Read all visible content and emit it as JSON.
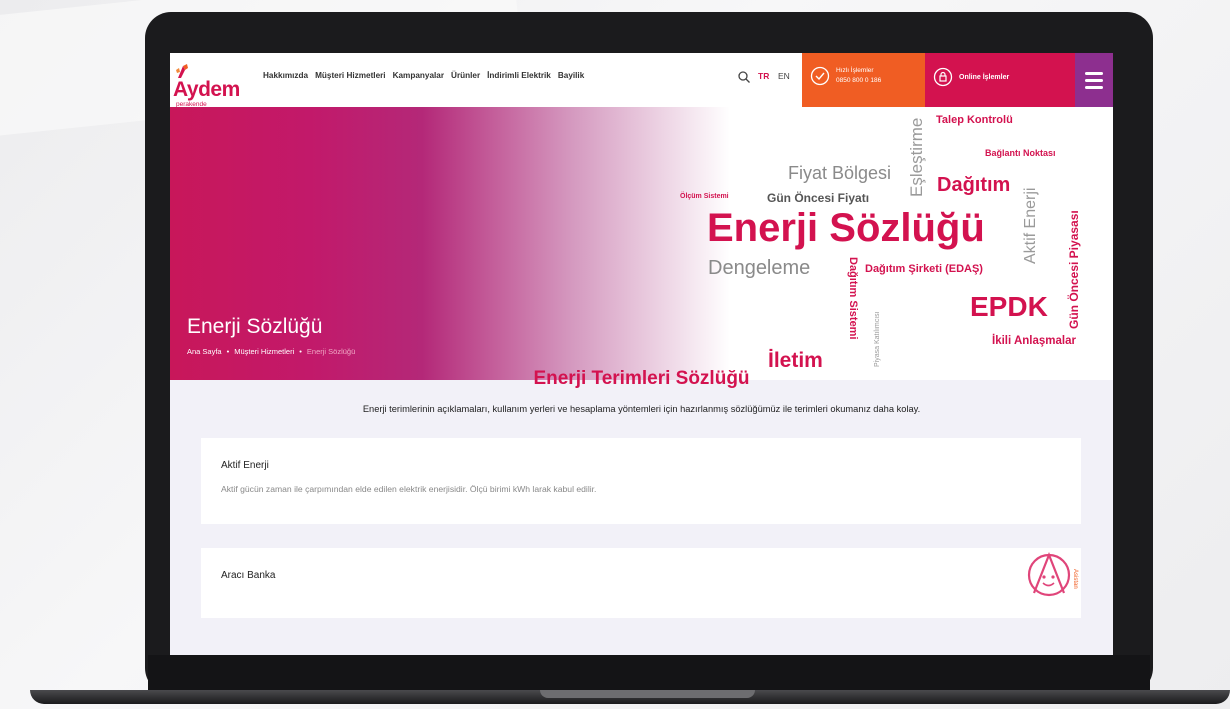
{
  "header": {
    "logo_text": "Aydem",
    "logo_subtext": "perakende",
    "nav": [
      "Hakkımızda",
      "Müşteri Hizmetleri",
      "Kampanyalar",
      "Ürünler",
      "İndirimli Elektrik",
      "Bayilik"
    ],
    "lang_tr": "TR",
    "lang_en": "EN",
    "quick_label": "Hızlı İşlemler",
    "quick_phone": "0850 800 0 186",
    "online_label": "Online İşlemler",
    "colors": {
      "brand": "#d3124f",
      "quick": "#f05d23",
      "menu": "#8d2f8f"
    }
  },
  "hero": {
    "title": "Enerji Sözlüğü",
    "breadcrumb": [
      "Ana Sayfa",
      "Müşteri Hizmetleri",
      "Enerji Sözlüğü"
    ],
    "cloud": {
      "talep": "Talep Kontrolü",
      "baglanti": "Bağlantı Noktası",
      "fiyat_bolgesi": "Fiyat Bölgesi",
      "eslestirme": "Eşleştirme",
      "dagitim": "Dağıtım",
      "olcum": "Ölçüm Sistemi",
      "gun_oncesi_fiyati": "Gün Öncesi Fiyatı",
      "enerji_sozlugu": "Enerji Sözlüğü",
      "aktif_enerji": "Aktif Enerji",
      "gop": "Gün Öncesi Piyasası",
      "dengeleme": "Dengeleme",
      "dagitim_sistemi": "Dağıtım Sistemi",
      "dagitim_sirketi": "Dağıtım Şirketi (EDAŞ)",
      "epdk": "EPDK",
      "piyasa": "Piyasa Katılımcısı",
      "ikili": "İkili Anlaşmalar",
      "iletim": "İletim"
    }
  },
  "content": {
    "title": "Enerji Terimleri Sözlüğü",
    "subtitle": "Enerji terimlerinin açıklamaları, kullanım yerleri ve hesaplama yöntemleri için hazırlanmış sözlüğümüz ile terimleri okumanız daha kolay.",
    "terms": [
      {
        "term": "Aktif Enerji",
        "desc": "Aktif gücün zaman ile çarpımından elde edilen elektrik enerjisidir. Ölçü birimi kWh larak kabul edilir."
      },
      {
        "term": "Aracı Banka",
        "desc": ""
      }
    ],
    "mascot_label": "Aydem Asistan"
  }
}
